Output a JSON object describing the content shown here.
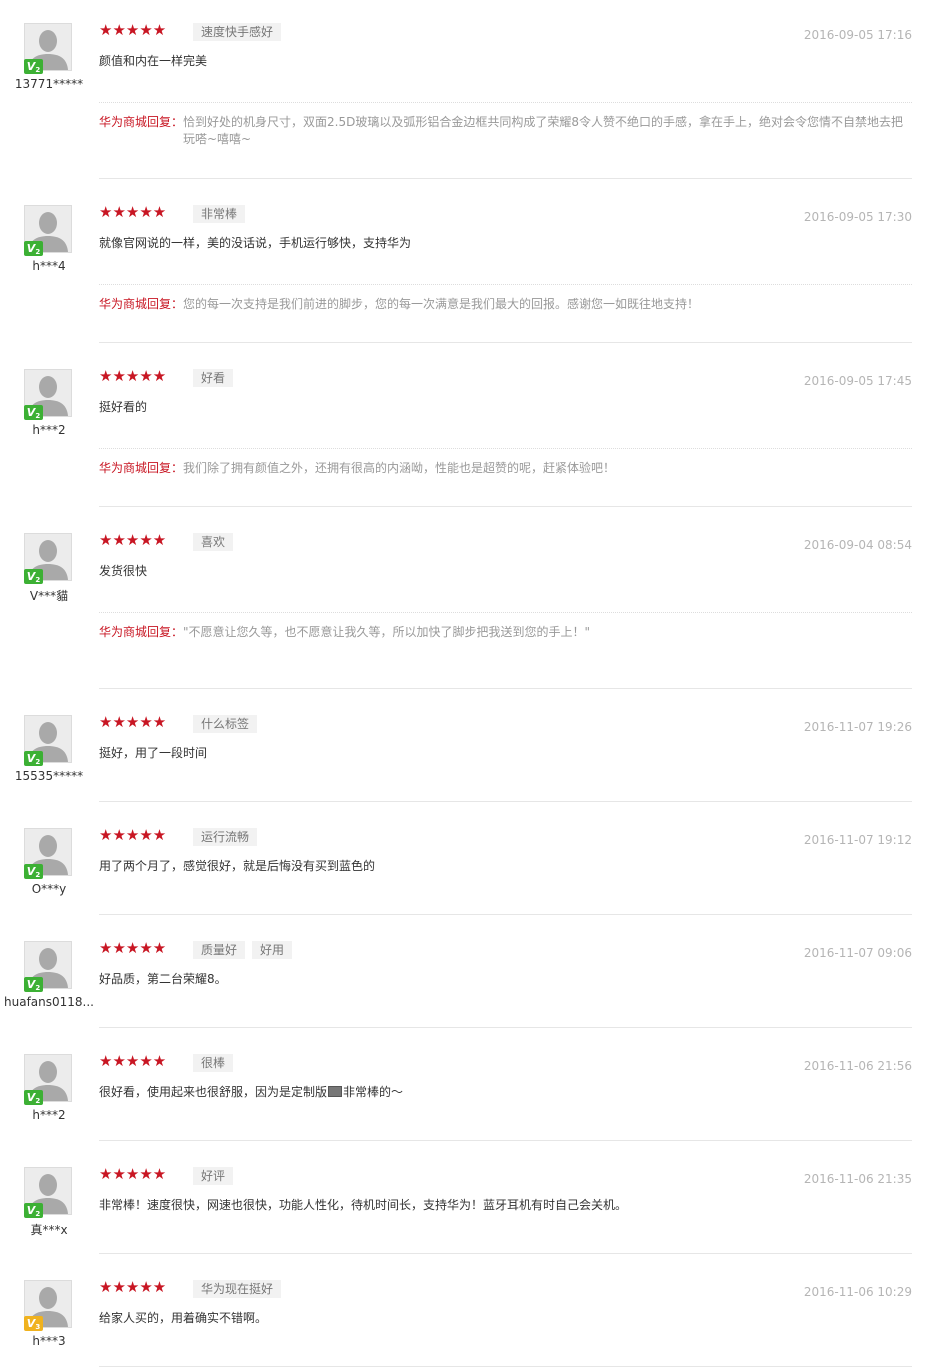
{
  "reviews": [
    {
      "username": "13771*****",
      "level": "V",
      "level_sub": "2",
      "level_color": "#3cb034",
      "stars": "★★★★★",
      "tags": [
        "速度快手感好"
      ],
      "date": "2016-09-05 17:16",
      "comment": "颜值和内在一样完美",
      "reply_label": "华为商城回复：",
      "reply": "恰到好处的机身尺寸，双面2.5D玻璃以及弧形铝合金边框共同构成了荣耀8令人赞不绝口的手感，拿在手上，绝对会令您情不自禁地去把玩嗒~嘻嘻~"
    },
    {
      "username": "h***4",
      "level": "V",
      "level_sub": "2",
      "level_color": "#3cb034",
      "stars": "★★★★★",
      "tags": [
        "非常棒"
      ],
      "date": "2016-09-05 17:30",
      "comment": "就像官网说的一样，美的没话说，手机运行够快，支持华为",
      "reply_label": "华为商城回复：",
      "reply": "您的每一次支持是我们前进的脚步，您的每一次满意是我们最大的回报。感谢您一如既往地支持！"
    },
    {
      "username": "h***2",
      "level": "V",
      "level_sub": "2",
      "level_color": "#3cb034",
      "stars": "★★★★★",
      "tags": [
        "好看"
      ],
      "date": "2016-09-05 17:45",
      "comment": "挺好看的",
      "reply_label": "华为商城回复：",
      "reply": "我们除了拥有颜值之外，还拥有很高的内涵呦，性能也是超赞的呢，赶紧体验吧！"
    },
    {
      "username": "V***貓",
      "level": "V",
      "level_sub": "2",
      "level_color": "#3cb034",
      "stars": "★★★★★",
      "tags": [
        "喜欢"
      ],
      "date": "2016-09-04 08:54",
      "comment": "发货很快",
      "reply_label": "华为商城回复：",
      "reply": "\"不愿意让您久等，也不愿意让我久等，所以加快了脚步把我送到您的手上！\""
    },
    {
      "username": "15535*****",
      "level": "V",
      "level_sub": "2",
      "level_color": "#3cb034",
      "stars": "★★★★★",
      "tags": [
        "什么标签"
      ],
      "date": "2016-11-07 19:26",
      "comment": "挺好，用了一段时间"
    },
    {
      "username": "O***y",
      "level": "V",
      "level_sub": "2",
      "level_color": "#3cb034",
      "stars": "★★★★★",
      "tags": [
        "运行流畅"
      ],
      "date": "2016-11-07 19:12",
      "comment": "用了两个月了，感觉很好，就是后悔没有买到蓝色的"
    },
    {
      "username": "huafans0118...",
      "level": "V",
      "level_sub": "2",
      "level_color": "#3cb034",
      "stars": "★★★★★",
      "tags": [
        "质量好",
        "好用"
      ],
      "date": "2016-11-07 09:06",
      "comment": "好品质，第二台荣耀8。"
    },
    {
      "username": "h***2",
      "level": "V",
      "level_sub": "2",
      "level_color": "#3cb034",
      "stars": "★★★★★",
      "tags": [
        "很棒"
      ],
      "date": "2016-11-06 21:56",
      "comment": "很好看，使用起来也很舒服，因为是定制版",
      "comment_tail": "非常棒的～"
    },
    {
      "username": "真***x",
      "level": "V",
      "level_sub": "2",
      "level_color": "#3cb034",
      "stars": "★★★★★",
      "tags": [
        "好评"
      ],
      "date": "2016-11-06 21:35",
      "comment": "非常棒！速度很快，网速也很快，功能人性化，待机时间长，支持华为！蓝牙耳机有时自己会关机。"
    },
    {
      "username": "h***3",
      "level": "V",
      "level_sub": "3",
      "level_color": "#f0b21e",
      "stars": "★★★★★",
      "tags": [
        "华为现在挺好"
      ],
      "date": "2016-11-06 10:29",
      "comment": "给家人买的，用着确实不错啊。"
    }
  ]
}
